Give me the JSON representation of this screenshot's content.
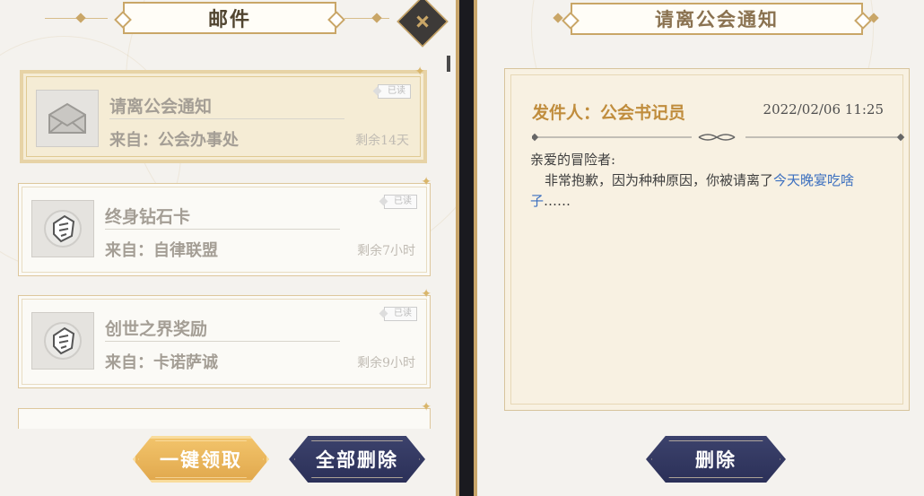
{
  "left_panel": {
    "title": "邮件",
    "mails": [
      {
        "title": "请离公会通知",
        "sender": "来自：公会办事处",
        "remaining": "剩余14天",
        "badge": "已读",
        "icon": "envelope-icon",
        "selected": true
      },
      {
        "title": "终身钻石卡",
        "sender": "来自：自律联盟",
        "remaining": "剩余7小时",
        "badge": "已读",
        "icon": "crest-icon",
        "selected": false
      },
      {
        "title": "创世之界奖励",
        "sender": "来自：卡诺萨诚",
        "remaining": "剩余9小时",
        "badge": "已读",
        "icon": "crest-icon",
        "selected": false
      }
    ],
    "buttons": {
      "claim_all": "一键领取",
      "delete_all": "全部删除"
    }
  },
  "right_panel": {
    "title": "请离公会通知",
    "sender_line": "发件人：公会书记员",
    "date": "2022/02/06 11:25",
    "greeting": "亲爱的冒险者:",
    "body_text": "非常抱歉，因为种种原因，你被请离了",
    "body_link": "今天晚宴吃啥子",
    "body_tail": "……",
    "delete_button": "删除"
  },
  "colors": {
    "gold_accent": "#c9a667",
    "navy_button": "#2f355d",
    "gold_button": "#e9b35b",
    "link": "#3b6fbf",
    "sender_gold": "#c08d3d"
  }
}
